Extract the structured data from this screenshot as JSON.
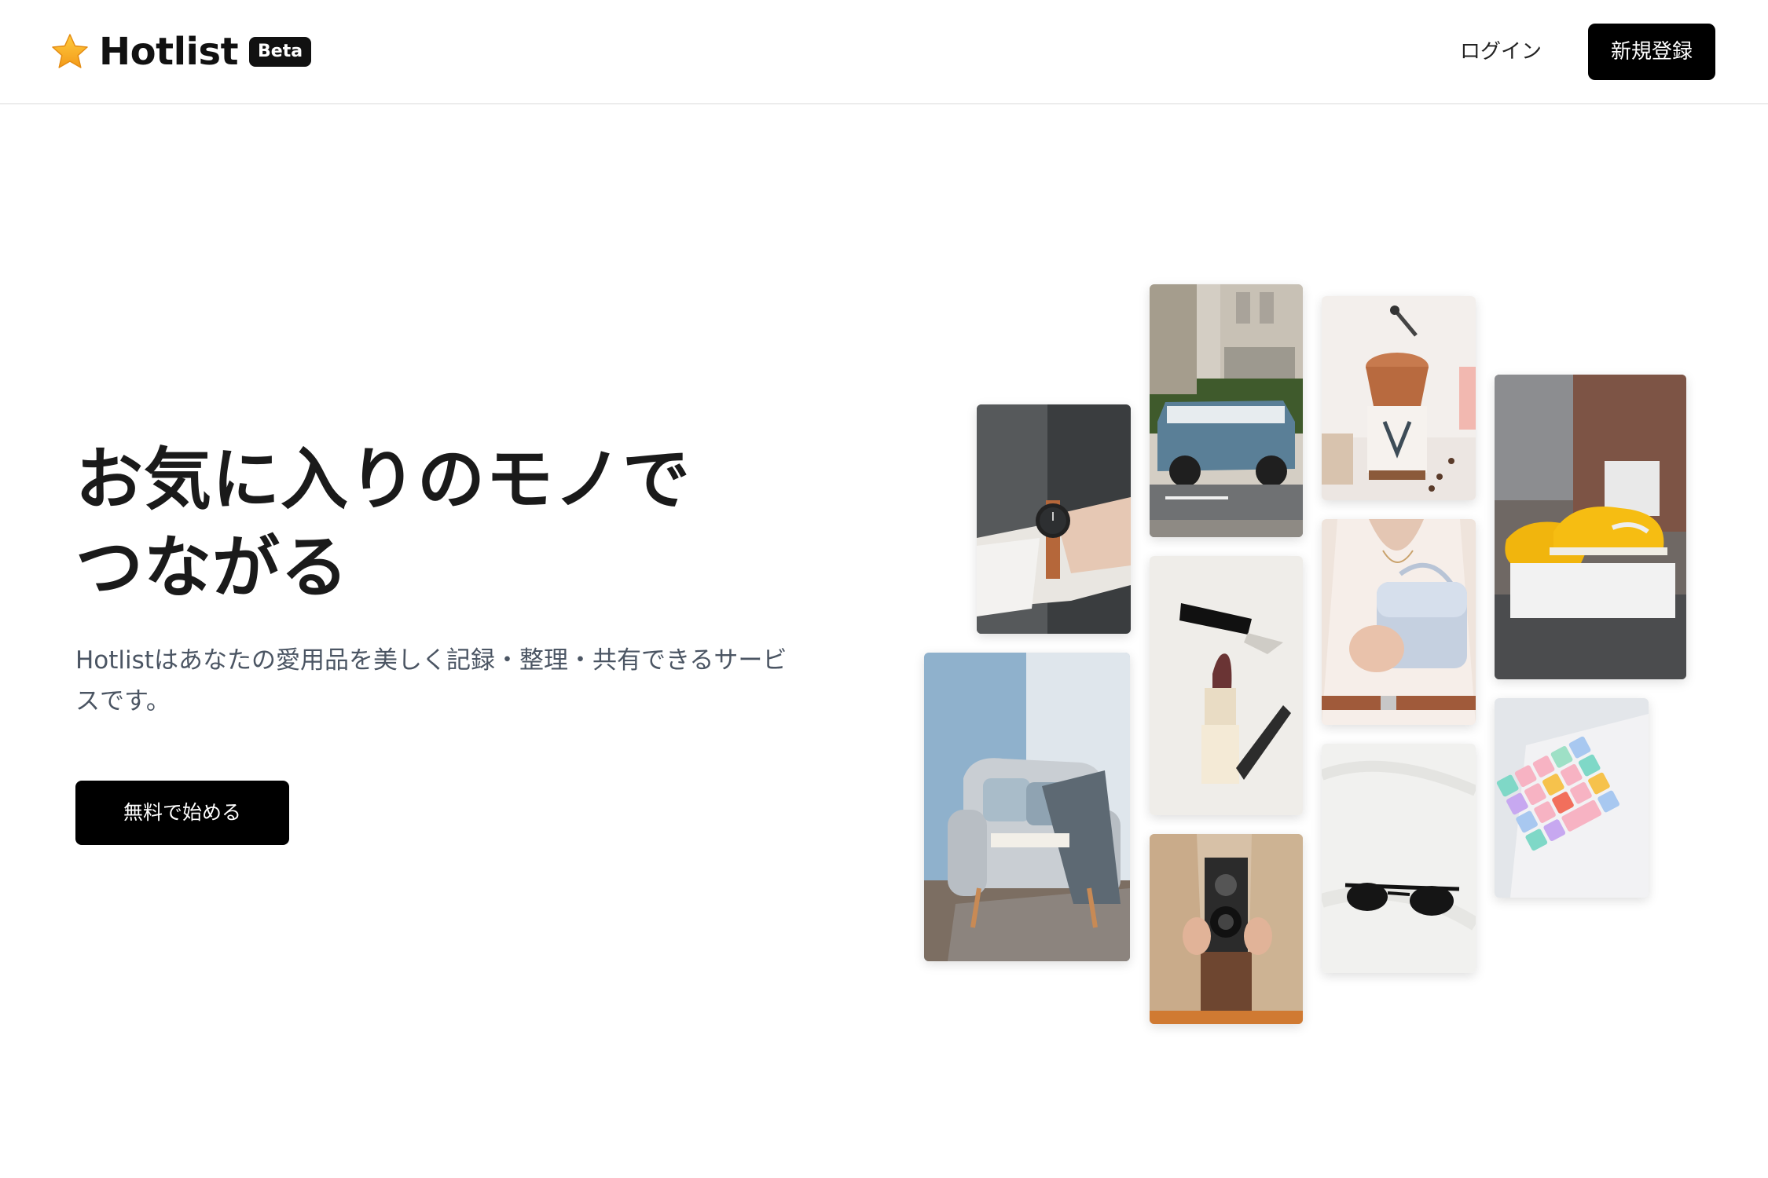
{
  "header": {
    "logo_text": "Hotlist",
    "badge": "Beta",
    "logo_icon": "star-icon",
    "login_label": "ログイン",
    "signup_label": "新規登録"
  },
  "hero": {
    "title_line1": "お気に入りのモノで",
    "title_line2": "つながる",
    "subtitle_line1": "Hotlistはあなたの愛用品を美しく記録・整理・共有できるサービ",
    "subtitle_line2": "スです。",
    "cta_label": "無料で始める"
  },
  "gallery": {
    "items": [
      "wristwatch-photo",
      "armchair-photo",
      "vintage-car-photo",
      "lipstick-photo",
      "twin-lens-camera-photo",
      "coffee-grinder-photo",
      "handbag-photo",
      "sunglasses-photo",
      "yellow-sneakers-photo",
      "pastel-keyboard-photo"
    ]
  },
  "colors": {
    "accent": "#000000",
    "star": "#f6a623",
    "subtitle": "#4b5563",
    "border": "#ececec"
  }
}
